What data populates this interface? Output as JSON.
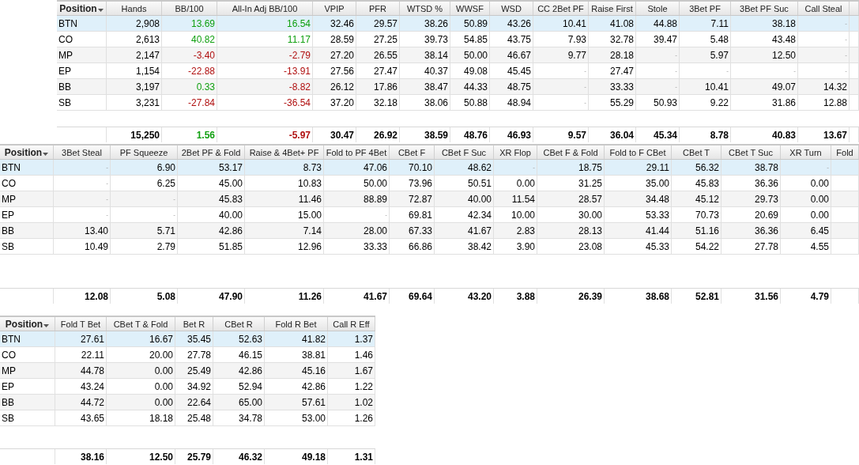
{
  "tables": [
    {
      "columns": [
        {
          "label": "Position",
          "sorted": true
        },
        {
          "label": "Hands",
          "sorted": false
        },
        {
          "label": "BB/100",
          "sorted": false
        },
        {
          "label": "All-In Adj BB/100",
          "sorted": false
        },
        {
          "label": "VPIP",
          "sorted": false
        },
        {
          "label": "PFR",
          "sorted": false
        },
        {
          "label": "WTSD %",
          "sorted": false
        },
        {
          "label": "WWSF",
          "sorted": false
        },
        {
          "label": "WSD",
          "sorted": false
        },
        {
          "label": "CC 2Bet PF",
          "sorted": false
        },
        {
          "label": "Raise First",
          "sorted": false
        },
        {
          "label": "Stole",
          "sorted": false
        },
        {
          "label": "3Bet PF",
          "sorted": false
        },
        {
          "label": "3Bet PF Suc",
          "sorted": false
        },
        {
          "label": "Call Steal",
          "sorted": false
        }
      ],
      "rows": [
        {
          "selected": true,
          "cells": [
            "BTN",
            "2,908",
            {
              "text": "13.69",
              "color": "#10a010"
            },
            {
              "text": "16.54",
              "color": "#10a010"
            },
            "32.46",
            "29.57",
            "38.26",
            "50.89",
            "43.26",
            "10.41",
            "41.08",
            "44.88",
            "7.11",
            "38.18",
            {
              "text": "-",
              "kind": "dash"
            }
          ]
        },
        {
          "selected": false,
          "cells": [
            "CO",
            "2,613",
            {
              "text": "40.82",
              "color": "#10a010"
            },
            {
              "text": "11.17",
              "color": "#10a010"
            },
            "28.59",
            "27.25",
            "39.73",
            "54.85",
            "43.75",
            "7.93",
            "32.78",
            "39.47",
            "5.48",
            "43.48",
            {
              "text": "-",
              "kind": "dash"
            }
          ]
        },
        {
          "selected": false,
          "cells": [
            "MP",
            "2,147",
            {
              "text": "-3.40",
              "color": "#b01010"
            },
            {
              "text": "-2.79",
              "color": "#b01010"
            },
            "27.20",
            "26.55",
            "38.14",
            "50.00",
            "46.67",
            "9.77",
            "28.18",
            {
              "text": "-",
              "kind": "dash"
            },
            "5.97",
            "12.50",
            {
              "text": "-",
              "kind": "dash"
            }
          ]
        },
        {
          "selected": false,
          "cells": [
            "EP",
            "1,154",
            {
              "text": "-22.88",
              "color": "#b01010"
            },
            {
              "text": "-13.91",
              "color": "#b01010"
            },
            "27.56",
            "27.47",
            "40.37",
            "49.08",
            "45.45",
            {
              "text": "-",
              "kind": "dash"
            },
            "27.47",
            {
              "text": "-",
              "kind": "dash"
            },
            {
              "text": "-",
              "kind": "dash"
            },
            {
              "text": "-",
              "kind": "dash"
            },
            {
              "text": "-",
              "kind": "dash"
            }
          ]
        },
        {
          "selected": false,
          "cells": [
            "BB",
            "3,197",
            {
              "text": "0.33",
              "color": "#10a010"
            },
            {
              "text": "-8.82",
              "color": "#b01010"
            },
            "26.12",
            "17.86",
            "38.47",
            "44.33",
            "48.75",
            {
              "text": "-",
              "kind": "dash"
            },
            "33.33",
            {
              "text": "-",
              "kind": "dash"
            },
            "10.41",
            "49.07",
            "14.32"
          ]
        },
        {
          "selected": false,
          "cells": [
            "SB",
            "3,231",
            {
              "text": "-27.84",
              "color": "#b01010"
            },
            {
              "text": "-36.54",
              "color": "#b01010"
            },
            "37.20",
            "32.18",
            "38.06",
            "50.88",
            "48.94",
            {
              "text": "-",
              "kind": "dash"
            },
            "55.29",
            "50.93",
            "9.22",
            "31.86",
            "12.88"
          ]
        }
      ],
      "totals": [
        "15,250",
        {
          "text": "1.56",
          "color": "#10a010"
        },
        {
          "text": "-5.97",
          "color": "#b01010"
        },
        "30.47",
        "26.92",
        "38.59",
        "48.76",
        "46.93",
        "9.57",
        "36.04",
        "45.34",
        "8.78",
        "40.83",
        "13.67"
      ]
    },
    {
      "columns": [
        {
          "label": "Position",
          "sorted": true
        },
        {
          "label": "3Bet Steal",
          "sorted": false
        },
        {
          "label": "PF Squeeze",
          "sorted": false
        },
        {
          "label": "2Bet PF & Fold",
          "sorted": false
        },
        {
          "label": "Raise & 4Bet+ PF",
          "sorted": false
        },
        {
          "label": "Fold to PF 4Bet",
          "sorted": false
        },
        {
          "label": "CBet F",
          "sorted": false
        },
        {
          "label": "CBet F Suc",
          "sorted": false
        },
        {
          "label": "XR Flop",
          "sorted": false
        },
        {
          "label": "CBet F & Fold",
          "sorted": false
        },
        {
          "label": "Fold to F CBet",
          "sorted": false
        },
        {
          "label": "CBet T",
          "sorted": false
        },
        {
          "label": "CBet T Suc",
          "sorted": false
        },
        {
          "label": "XR Turn",
          "sorted": false
        },
        {
          "label": "Fold",
          "sorted": false
        }
      ],
      "rows": [
        {
          "selected": true,
          "cells": [
            "BTN",
            {
              "text": "-",
              "kind": "dash"
            },
            "6.90",
            "53.17",
            "8.73",
            "47.06",
            "70.10",
            "48.62",
            {
              "text": "-",
              "kind": "dash"
            },
            "18.75",
            "29.11",
            "56.32",
            "38.78",
            {
              "text": "-",
              "kind": "dash"
            }
          ]
        },
        {
          "selected": false,
          "cells": [
            "CO",
            {
              "text": "-",
              "kind": "dash"
            },
            "6.25",
            "45.00",
            "10.83",
            "50.00",
            "73.96",
            "50.51",
            "0.00",
            "31.25",
            "35.00",
            "45.83",
            "36.36",
            "0.00"
          ]
        },
        {
          "selected": false,
          "cells": [
            "MP",
            {
              "text": "-",
              "kind": "dash"
            },
            {
              "text": "-",
              "kind": "dash"
            },
            "45.83",
            "11.46",
            "88.89",
            "72.87",
            "40.00",
            "11.54",
            "28.57",
            "34.48",
            "45.12",
            "29.73",
            "0.00"
          ]
        },
        {
          "selected": false,
          "cells": [
            "EP",
            {
              "text": "-",
              "kind": "dash"
            },
            {
              "text": "-",
              "kind": "dash"
            },
            "40.00",
            "15.00",
            {
              "text": "-",
              "kind": "dash"
            },
            "69.81",
            "42.34",
            "10.00",
            "30.00",
            "53.33",
            "70.73",
            "20.69",
            "0.00"
          ]
        },
        {
          "selected": false,
          "cells": [
            "BB",
            "13.40",
            "5.71",
            "42.86",
            "7.14",
            "28.00",
            "67.33",
            "41.67",
            "2.83",
            "28.13",
            "41.44",
            "51.16",
            "36.36",
            "6.45"
          ]
        },
        {
          "selected": false,
          "cells": [
            "SB",
            "10.49",
            "2.79",
            "51.85",
            "12.96",
            "33.33",
            "66.86",
            "38.42",
            "3.90",
            "23.08",
            "45.33",
            "54.22",
            "27.78",
            "4.55"
          ]
        }
      ],
      "totals": [
        "12.08",
        "5.08",
        "47.90",
        "11.26",
        "41.67",
        "69.64",
        "43.20",
        "3.88",
        "26.39",
        "38.68",
        "52.81",
        "31.56",
        "4.79"
      ]
    },
    {
      "columns": [
        {
          "label": "Position",
          "sorted": true
        },
        {
          "label": "Fold T Bet",
          "sorted": false
        },
        {
          "label": "CBet T & Fold",
          "sorted": false
        },
        {
          "label": "Bet R",
          "sorted": false
        },
        {
          "label": "CBet R",
          "sorted": false
        },
        {
          "label": "Fold R Bet",
          "sorted": false
        },
        {
          "label": "Call R Eff",
          "sorted": false
        }
      ],
      "rows": [
        {
          "selected": true,
          "cells": [
            "BTN",
            "27.61",
            "16.67",
            "35.45",
            "52.63",
            "41.82",
            "1.37"
          ]
        },
        {
          "selected": false,
          "cells": [
            "CO",
            "22.11",
            "20.00",
            "27.78",
            "46.15",
            "38.81",
            "1.46"
          ]
        },
        {
          "selected": false,
          "cells": [
            "MP",
            "44.78",
            "0.00",
            "25.49",
            "42.86",
            "45.16",
            "1.67"
          ]
        },
        {
          "selected": false,
          "cells": [
            "EP",
            "43.24",
            "0.00",
            "34.92",
            "52.94",
            "42.86",
            "1.22"
          ]
        },
        {
          "selected": false,
          "cells": [
            "BB",
            "44.72",
            "0.00",
            "22.64",
            "65.00",
            "57.61",
            "1.02"
          ]
        },
        {
          "selected": false,
          "cells": [
            "SB",
            "43.65",
            "18.18",
            "25.48",
            "34.78",
            "53.00",
            "1.26"
          ]
        }
      ],
      "totals": [
        "38.16",
        "12.50",
        "25.79",
        "46.32",
        "49.18",
        "1.31"
      ]
    }
  ]
}
